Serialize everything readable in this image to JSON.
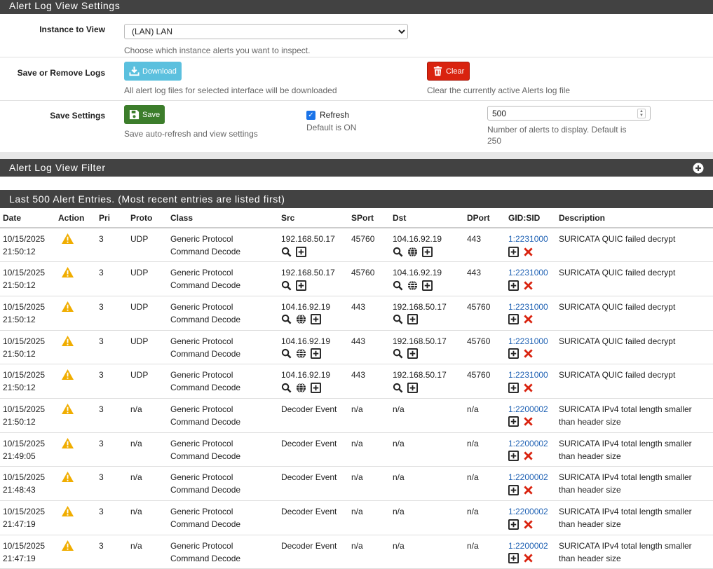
{
  "settings": {
    "title": "Alert Log View Settings",
    "instance_label": "Instance to View",
    "instance_value": "(LAN) LAN",
    "instance_help": "Choose which instance alerts you want to inspect.",
    "save_remove_label": "Save or Remove Logs",
    "download_label": "Download",
    "download_help": "All alert log files for selected interface will be downloaded",
    "clear_label": "Clear",
    "clear_help": "Clear the currently active Alerts log file",
    "save_settings_label": "Save Settings",
    "save_label": "Save",
    "save_help": "Save auto-refresh and view settings",
    "refresh_label": "Refresh",
    "refresh_help": "Default is ON",
    "refresh_checked": true,
    "alerts_count": "500",
    "alerts_help": "Number of alerts to display. Default is 250"
  },
  "filter": {
    "title": "Alert Log View Filter"
  },
  "entries": {
    "title": "Last 500 Alert Entries. (Most recent entries are listed first)",
    "columns": [
      "Date",
      "Action",
      "Pri",
      "Proto",
      "Class",
      "Src",
      "SPort",
      "Dst",
      "DPort",
      "GID:SID",
      "Description"
    ],
    "rows": [
      {
        "date": "10/15/2025",
        "time": "21:50:12",
        "pri": "3",
        "proto": "UDP",
        "class1": "Generic Protocol",
        "class2": "Command Decode",
        "src": "192.168.50.17",
        "src_icons": [
          "search",
          "plus"
        ],
        "sport": "45760",
        "dst": "104.16.92.19",
        "dst_icons": [
          "search",
          "globe",
          "plus"
        ],
        "dport": "443",
        "gidsid": "1:2231000",
        "desc": "SURICATA QUIC failed decrypt"
      },
      {
        "date": "10/15/2025",
        "time": "21:50:12",
        "pri": "3",
        "proto": "UDP",
        "class1": "Generic Protocol",
        "class2": "Command Decode",
        "src": "192.168.50.17",
        "src_icons": [
          "search",
          "plus"
        ],
        "sport": "45760",
        "dst": "104.16.92.19",
        "dst_icons": [
          "search",
          "globe",
          "plus"
        ],
        "dport": "443",
        "gidsid": "1:2231000",
        "desc": "SURICATA QUIC failed decrypt"
      },
      {
        "date": "10/15/2025",
        "time": "21:50:12",
        "pri": "3",
        "proto": "UDP",
        "class1": "Generic Protocol",
        "class2": "Command Decode",
        "src": "104.16.92.19",
        "src_icons": [
          "search",
          "globe",
          "plus"
        ],
        "sport": "443",
        "dst": "192.168.50.17",
        "dst_icons": [
          "search",
          "plus"
        ],
        "dport": "45760",
        "gidsid": "1:2231000",
        "desc": "SURICATA QUIC failed decrypt"
      },
      {
        "date": "10/15/2025",
        "time": "21:50:12",
        "pri": "3",
        "proto": "UDP",
        "class1": "Generic Protocol",
        "class2": "Command Decode",
        "src": "104.16.92.19",
        "src_icons": [
          "search",
          "globe",
          "plus"
        ],
        "sport": "443",
        "dst": "192.168.50.17",
        "dst_icons": [
          "search",
          "plus"
        ],
        "dport": "45760",
        "gidsid": "1:2231000",
        "desc": "SURICATA QUIC failed decrypt"
      },
      {
        "date": "10/15/2025",
        "time": "21:50:12",
        "pri": "3",
        "proto": "UDP",
        "class1": "Generic Protocol",
        "class2": "Command Decode",
        "src": "104.16.92.19",
        "src_icons": [
          "search",
          "globe",
          "plus"
        ],
        "sport": "443",
        "dst": "192.168.50.17",
        "dst_icons": [
          "search",
          "plus"
        ],
        "dport": "45760",
        "gidsid": "1:2231000",
        "desc": "SURICATA QUIC failed decrypt"
      },
      {
        "date": "10/15/2025",
        "time": "21:50:12",
        "pri": "3",
        "proto": "n/a",
        "class1": "Generic Protocol",
        "class2": "Command Decode",
        "src": "Decoder Event",
        "src_icons": [],
        "sport": "n/a",
        "dst": "n/a",
        "dst_icons": [],
        "dport": "n/a",
        "gidsid": "1:2200002",
        "desc": "SURICATA IPv4 total length smaller than header size"
      },
      {
        "date": "10/15/2025",
        "time": "21:49:05",
        "pri": "3",
        "proto": "n/a",
        "class1": "Generic Protocol",
        "class2": "Command Decode",
        "src": "Decoder Event",
        "src_icons": [],
        "sport": "n/a",
        "dst": "n/a",
        "dst_icons": [],
        "dport": "n/a",
        "gidsid": "1:2200002",
        "desc": "SURICATA IPv4 total length smaller than header size"
      },
      {
        "date": "10/15/2025",
        "time": "21:48:43",
        "pri": "3",
        "proto": "n/a",
        "class1": "Generic Protocol",
        "class2": "Command Decode",
        "src": "Decoder Event",
        "src_icons": [],
        "sport": "n/a",
        "dst": "n/a",
        "dst_icons": [],
        "dport": "n/a",
        "gidsid": "1:2200002",
        "desc": "SURICATA IPv4 total length smaller than header size"
      },
      {
        "date": "10/15/2025",
        "time": "21:47:19",
        "pri": "3",
        "proto": "n/a",
        "class1": "Generic Protocol",
        "class2": "Command Decode",
        "src": "Decoder Event",
        "src_icons": [],
        "sport": "n/a",
        "dst": "n/a",
        "dst_icons": [],
        "dport": "n/a",
        "gidsid": "1:2200002",
        "desc": "SURICATA IPv4 total length smaller than header size"
      },
      {
        "date": "10/15/2025",
        "time": "21:47:19",
        "pri": "3",
        "proto": "n/a",
        "class1": "Generic Protocol",
        "class2": "Command Decode",
        "src": "Decoder Event",
        "src_icons": [],
        "sport": "n/a",
        "dst": "n/a",
        "dst_icons": [],
        "dport": "n/a",
        "gidsid": "1:2200002",
        "desc": "SURICATA IPv4 total length smaller than header size"
      }
    ]
  },
  "colors": {
    "heading_bg": "#424242",
    "link": "#2062b4",
    "warning": "#f0ad00",
    "danger": "#d9230f",
    "success": "#3c7d2b",
    "info": "#5bc0de"
  }
}
